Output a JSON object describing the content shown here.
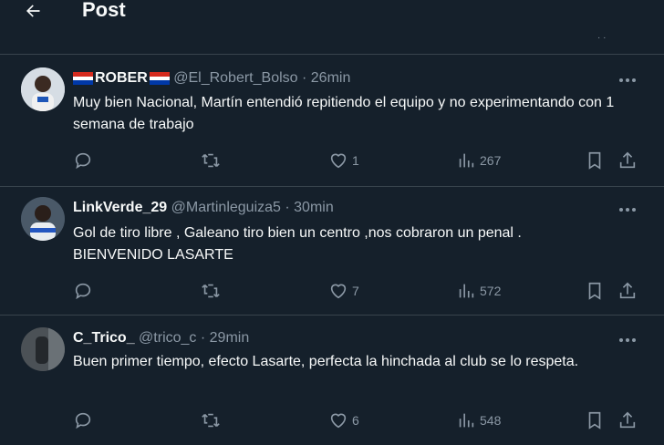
{
  "header": {
    "title": "Post"
  },
  "colors": {
    "background": "#15202b",
    "muted": "#8b98a5",
    "divider": "#38444d",
    "text": "#f7f9f9"
  },
  "tweets": [
    {
      "name": "ROBER",
      "name_prefix_flag": "paraguay-flag",
      "name_suffix_flag": "paraguay-flag",
      "handle": "@El_Robert_Bolso",
      "dot": "·",
      "time": "26min",
      "text": "Muy bien Nacional, Martín entendió repitiendo el equipo y no experimentando con 1 semana de trabajo",
      "likes": "1",
      "views": "267"
    },
    {
      "name": "LinkVerde_29",
      "handle": "@Martinleguiza5",
      "dot": "·",
      "time": "30min",
      "text_line1": "Gol de tiro libre , Galeano tiro bien un centro ,nos cobraron un penal .",
      "text_line2": "BIENVENIDO LASARTE",
      "likes": "7",
      "views": "572"
    },
    {
      "name": "C_Trico_",
      "handle": "@trico_c",
      "dot": "·",
      "time": "29min",
      "text": "Buen primer tiempo, efecto Lasarte, perfecta la hinchada al club se lo respeta.",
      "likes": "6",
      "views": "548"
    }
  ]
}
